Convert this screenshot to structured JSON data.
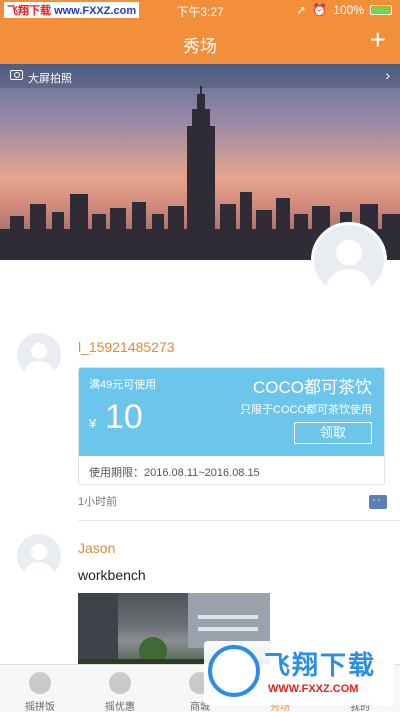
{
  "status_bar": {
    "watermark_left": "飞翔下载",
    "watermark_url": "www.FXXZ.com",
    "time": "下午3:27",
    "battery": "100%"
  },
  "navbar": {
    "title": "秀场",
    "plus_icon": "plus-icon"
  },
  "banner": {
    "label": "大屏拍照",
    "camera_icon": "camera-icon",
    "chevron": "›"
  },
  "posts": [
    {
      "username": "l_15921485273",
      "coupon": {
        "condition": "满49元可使用",
        "currency": "¥",
        "amount": "10",
        "shop": "COCO都可茶饮",
        "note": "只限于COCO都可茶饮使用",
        "button": "领取",
        "validity": "使用期限：2016.08.11~2016.08.15"
      },
      "time_ago": "1小时前"
    },
    {
      "username": "Jason",
      "text": "workbench"
    }
  ],
  "tabbar": {
    "items": [
      {
        "label": "摇拼饭",
        "active": false
      },
      {
        "label": "摇优惠",
        "active": false
      },
      {
        "label": "商城",
        "active": false
      },
      {
        "label": "秀场",
        "active": true
      },
      {
        "label": "我的",
        "active": false
      }
    ]
  },
  "watermark_bottom": {
    "brand": "飞翔下载",
    "url": "WWW.FXXZ.COM"
  },
  "colors": {
    "accent": "#f38f3a",
    "coupon": "#6cc6ec",
    "username": "#e28b3b"
  }
}
